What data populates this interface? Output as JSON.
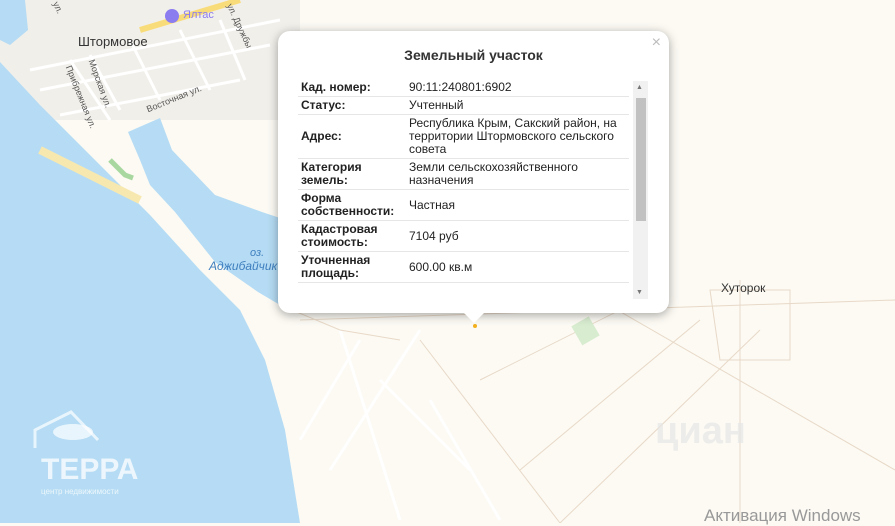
{
  "map": {
    "places": [
      "Штормовое",
      "Хуторок"
    ],
    "poi": "Ялтас",
    "lake": [
      "оз.",
      "Аджибайчик"
    ],
    "streets": [
      "Морская ул.",
      "Прибрежная ул.",
      "Восточная ул.",
      "ул. Дружбы",
      "ул."
    ],
    "colors": {
      "water": "#b5dcf4",
      "land": "#fcfaf3",
      "road": "#ffffff",
      "poi": "#8b7cf0"
    }
  },
  "popup": {
    "title": "Земельный участок",
    "close": "×",
    "rows": [
      {
        "key": "Кад. номер:",
        "value": "90:11:240801:6902"
      },
      {
        "key": "Статус:",
        "value": "Учтенный"
      },
      {
        "key": "Адрес:",
        "value": "Республика Крым, Сакский район, на территории Штормовского сельского совета"
      },
      {
        "key": "Категория земель:",
        "value": "Земли сельскохозяйственного назначения"
      },
      {
        "key": "Форма собственности:",
        "value": "Частная"
      },
      {
        "key": "Кадастровая стоимость:",
        "value": "7104 руб"
      },
      {
        "key": "Уточненная площадь:",
        "value": "600.00 кв.м"
      }
    ]
  },
  "logo": {
    "name": "ТЕРРА",
    "tagline": "центр недвижимости"
  },
  "cian": "циан",
  "os_watermark": "Активация Windows"
}
